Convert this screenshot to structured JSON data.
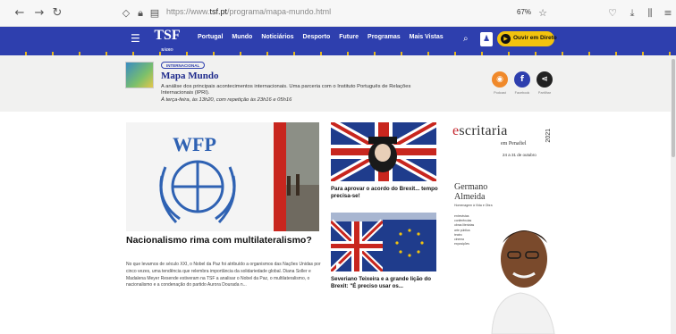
{
  "browser": {
    "back": "←",
    "forward": "→",
    "reload": "↻",
    "url_prefix": "https://www.",
    "url_domain": "tsf.pt",
    "url_path": "/programa/mapa-mundo.html",
    "zoom": "67%"
  },
  "nav": {
    "logo": "TSF",
    "logo_sub": "RÁDIO NOTÍCIAS",
    "links": [
      "Portugal",
      "Mundo",
      "Noticiários",
      "Desporto",
      "Future",
      "Programas",
      "Mais Vistas"
    ],
    "live_label": "Ouvir em Direto"
  },
  "program": {
    "tag": "INTERNACIONAL",
    "title": "Mapa Mundo",
    "description": "A análise dos principais acontecimentos internacionais. Uma parceria com o Instituto Português de Relações Internacionais (IPRI).",
    "schedule": "À terça-feira, às 13h20, com repetição às 23h16 e 05h16",
    "social": [
      {
        "label": "Podcast",
        "glyph": "◉",
        "color": "#f0892a"
      },
      {
        "label": "Facebook",
        "glyph": "f",
        "color": "#2e3fae"
      },
      {
        "label": "Partilhar",
        "glyph": "⋖",
        "color": "#222222"
      }
    ]
  },
  "feature": {
    "img_text": "WFP",
    "title": "Nacionalismo rima com multilateralismo?",
    "text": "No que levamos de século XXI, o Nobel da Paz foi atribuído a organismos das Nações Unidas por cinco vezes, uma tendência que relembra importância da solidariedade global. Diana Soller e Madalena Meyer Resende estiveram na TSF a analisar o Nobel da Paz, o multilateralismo, o nacionalismo e a condenação do partido Aurora Dourada n..."
  },
  "stories": [
    {
      "title": "Para aprovar o acordo do Brexit... tempo precisa-se!"
    },
    {
      "title": "Severiano Teixeira e a grande lição do Brexit: \"É preciso usar os..."
    }
  ],
  "ad": {
    "brand_e": "e",
    "brand_rest": "scritaria",
    "year": "2021",
    "place": "em Penafiel",
    "dates": "24 a 31 de outubro",
    "name_line1": "Germano",
    "name_line2": "Almeida",
    "subtitle": "Homenagem à Vida e Obra",
    "list": [
      "entrevistas",
      "conferências",
      "obras literárias",
      "arte pública",
      "teatro",
      "cinema",
      "exposições"
    ]
  }
}
